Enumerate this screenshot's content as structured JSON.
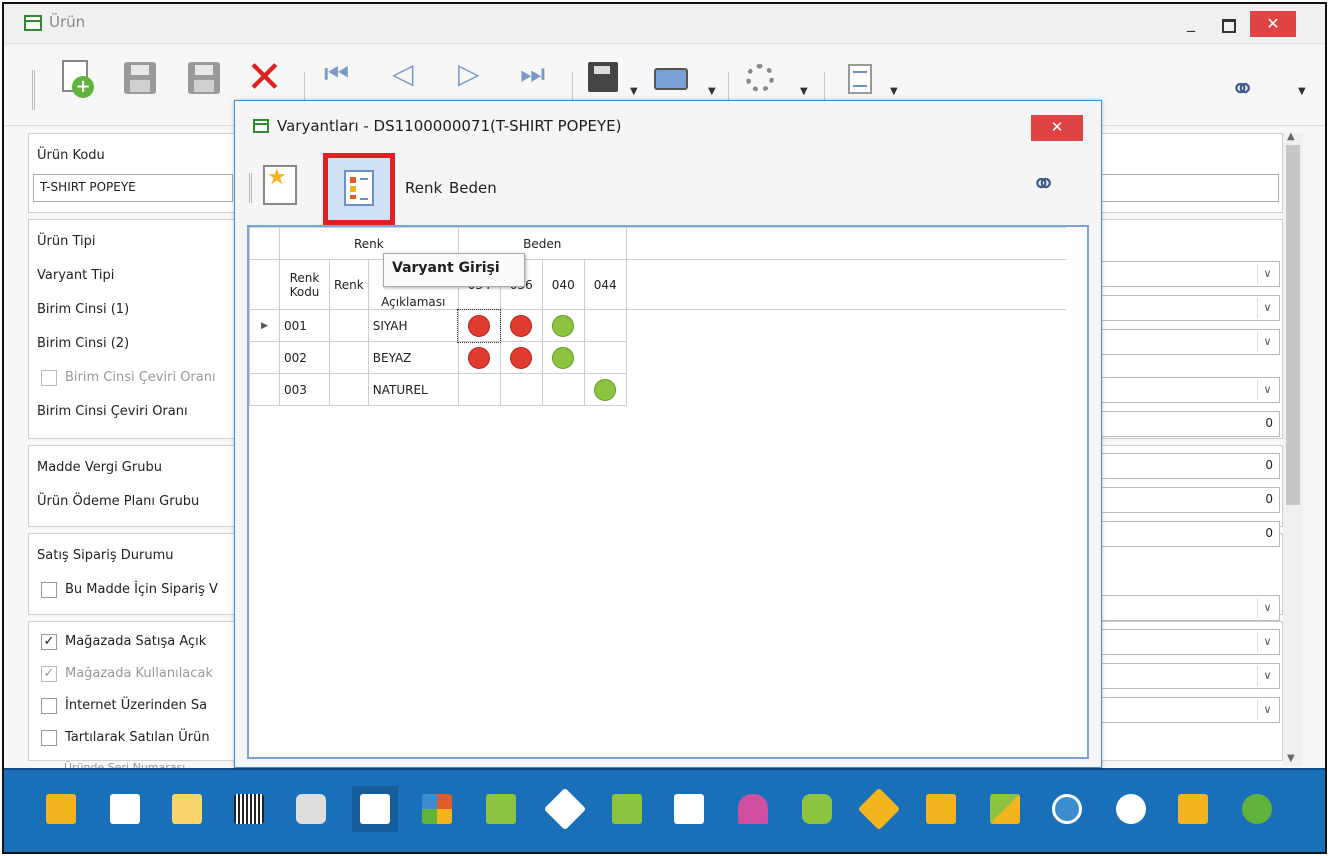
{
  "window": {
    "title": "Ürün",
    "minimize": "_",
    "close": "✕"
  },
  "form": {
    "fields": [
      {
        "label": "Ürün Kodu"
      },
      {
        "label": "Ürün Tipi"
      },
      {
        "label": "Varyant Tipi"
      },
      {
        "label": "Birim Cinsi (1)"
      },
      {
        "label": "Birim Cinsi (2)"
      },
      {
        "label": "Birim Cinsi Çeviri Oranı",
        "disabled": true
      },
      {
        "label": "Birim Cinsi Çeviri Oranı"
      },
      {
        "label": "Madde Vergi Grubu"
      },
      {
        "label": "Ürün Ödeme Planı Grubu"
      },
      {
        "label": "Satış Sipariş Durumu"
      },
      {
        "label": "Bu Madde İçin Sipariş V"
      },
      {
        "label": "Mağazada Satışa Açık",
        "checked": true
      },
      {
        "label": "Mağazada Kullanılacak",
        "checked": true,
        "disabled": true
      },
      {
        "label": "İnternet Üzerinden Sa"
      },
      {
        "label": "Tartılarak Satılan Ürün"
      },
      {
        "label": "Üründe Seri Numarası"
      }
    ],
    "product_code_value": "T-SHIRT POPEYE",
    "numeric_values": [
      "0",
      "0",
      "0",
      "0"
    ]
  },
  "modal": {
    "title": "Varyantları - DS1100000071(T-SHIRT POPEYE)",
    "close": "✕",
    "tabs": [
      "Renk",
      "Beden"
    ],
    "tooltip": "Varyant Girişi",
    "grid": {
      "group_headers": [
        "Renk",
        "Beden"
      ],
      "columns": [
        "Renk Kodu",
        "Renk",
        "Açıklaması",
        "034",
        "036",
        "040",
        "044"
      ],
      "rows": [
        {
          "code": "001",
          "renk": "",
          "desc": "SIYAH",
          "sizes": [
            "red",
            "red",
            "green",
            ""
          ]
        },
        {
          "code": "002",
          "renk": "",
          "desc": "BEYAZ",
          "sizes": [
            "red",
            "red",
            "green",
            ""
          ]
        },
        {
          "code": "003",
          "renk": "",
          "desc": "NATUREL",
          "sizes": [
            "",
            "",
            "",
            "green"
          ]
        }
      ]
    }
  },
  "colors": {
    "close_red": "#e04343",
    "bottom_bar": "#1a6fb9",
    "highlight": "#e31e24",
    "dot_red": "#e03b2f",
    "dot_green": "#8cc441"
  }
}
